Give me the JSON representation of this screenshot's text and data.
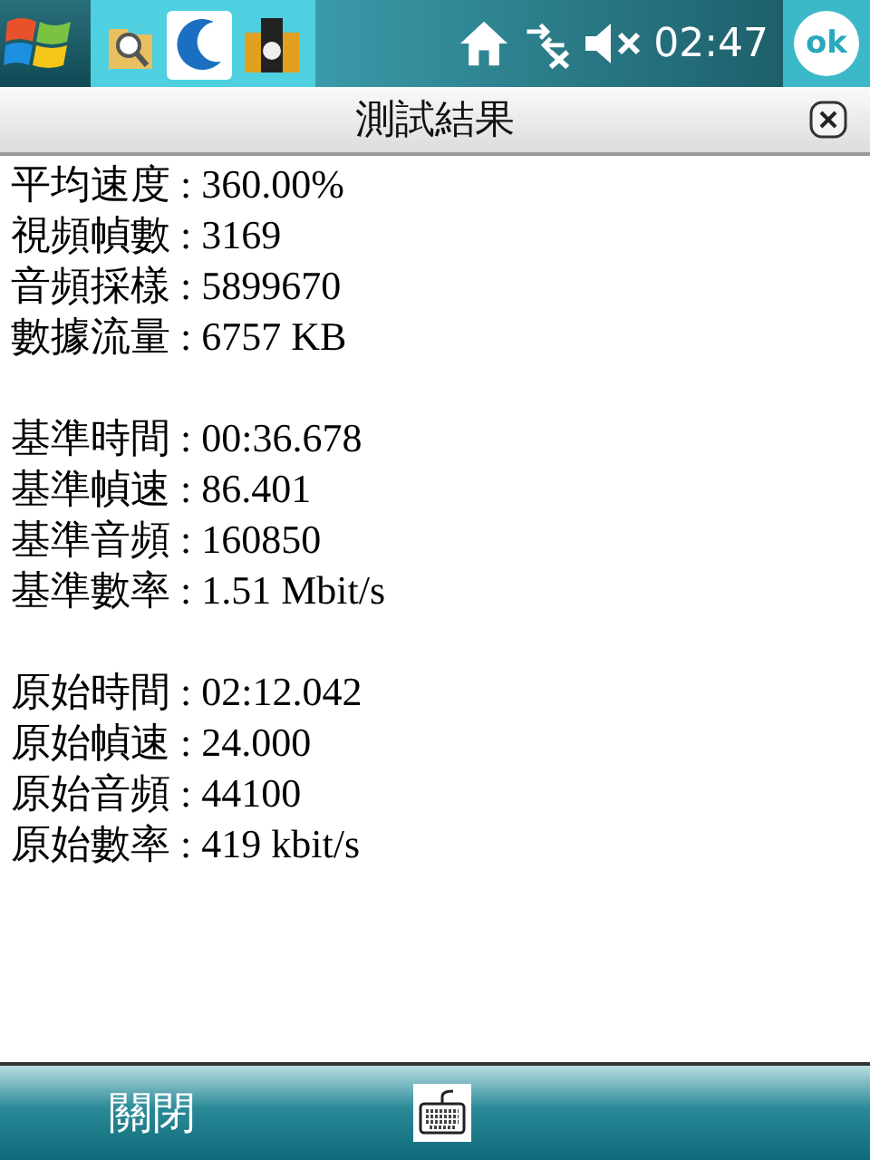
{
  "status_bar": {
    "time": "02:47",
    "ok_button": "ok"
  },
  "title_bar": {
    "title": "測試結果"
  },
  "groups": [
    {
      "lines": [
        "平均速度 : 360.00%",
        "視頻幀數 : 3169",
        "音頻採樣 : 5899670",
        "數據流量 : 6757 KB"
      ]
    },
    {
      "lines": [
        "基準時間 : 00:36.678",
        "基準幀速 : 86.401",
        "基準音頻 : 160850",
        "基準數率 : 1.51 Mbit/s"
      ]
    },
    {
      "lines": [
        "原始時間 : 02:12.042",
        "原始幀速 : 24.000",
        "原始音頻 : 44100",
        "原始數率 : 419 kbit/s"
      ]
    }
  ],
  "softkeys": {
    "left": "關閉"
  }
}
